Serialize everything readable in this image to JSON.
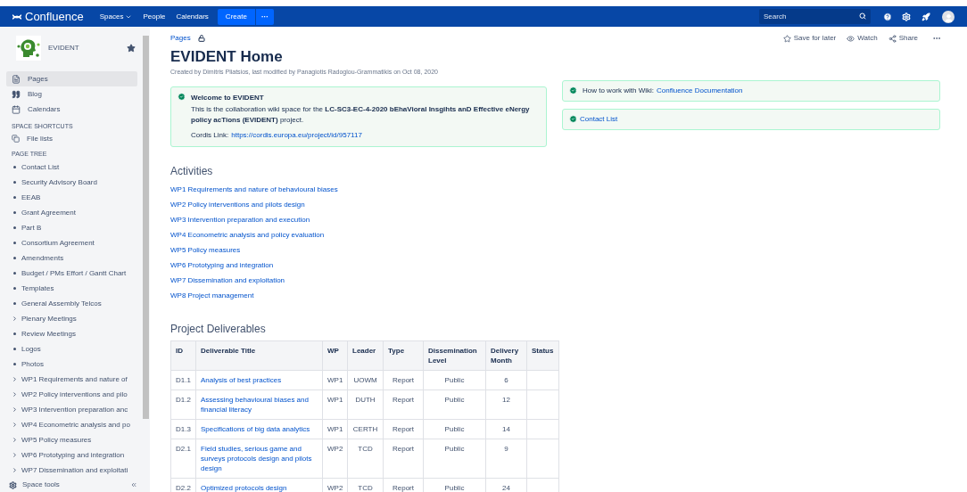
{
  "header": {
    "logo": "Confluence",
    "nav": [
      {
        "label": "Spaces",
        "dropdown": true
      },
      {
        "label": "People",
        "dropdown": false
      },
      {
        "label": "Calendars",
        "dropdown": false
      }
    ],
    "create": "Create",
    "more": "···",
    "search": {
      "placeholder": "Search"
    }
  },
  "sidebar": {
    "space_name": "EVIDENT",
    "nav": [
      {
        "label": "Pages",
        "selected": true
      },
      {
        "label": "Blog",
        "selected": false
      },
      {
        "label": "Calendars",
        "selected": false
      }
    ],
    "shortcuts_heading": "SPACE SHORTCUTS",
    "shortcuts": [
      "File lists"
    ],
    "tree_heading": "PAGE TREE",
    "tree": [
      {
        "label": "Contact List",
        "kind": "leaf"
      },
      {
        "label": "Security Advisory Board",
        "kind": "leaf"
      },
      {
        "label": "EEAB",
        "kind": "leaf"
      },
      {
        "label": "Grant Agreement",
        "kind": "leaf"
      },
      {
        "label": "Part B",
        "kind": "leaf"
      },
      {
        "label": "Consortium Agreement",
        "kind": "leaf"
      },
      {
        "label": "Amendments",
        "kind": "leaf"
      },
      {
        "label": "Budget / PMs Effort / Gantt Chart",
        "kind": "leaf"
      },
      {
        "label": "Templates",
        "kind": "leaf"
      },
      {
        "label": "General Assembly Telcos",
        "kind": "leaf"
      },
      {
        "label": "Plenary Meetings",
        "kind": "folder"
      },
      {
        "label": "Review Meetings",
        "kind": "leaf"
      },
      {
        "label": "Logos",
        "kind": "leaf"
      },
      {
        "label": "Photos",
        "kind": "leaf"
      },
      {
        "label": "WP1 Requirements and nature of",
        "kind": "folder"
      },
      {
        "label": "WP2 Policy interventions and pilo",
        "kind": "folder"
      },
      {
        "label": "WP3 Intervention preparation anc",
        "kind": "folder"
      },
      {
        "label": "WP4 Econometric analysis and po",
        "kind": "folder"
      },
      {
        "label": "WP5 Policy measures",
        "kind": "folder"
      },
      {
        "label": "WP6 Prototyping and integration",
        "kind": "folder"
      },
      {
        "label": "WP7 Dissemination and exploitati",
        "kind": "folder"
      }
    ],
    "footer": "Space tools"
  },
  "page": {
    "breadcrumb": "Pages",
    "actions": [
      "Save for later",
      "Watch",
      "Share"
    ],
    "title": "EVIDENT Home",
    "byline": "Created by Dimitris Pliatsios, last modified by Panagiotis Radoglou-Grammatikis on Oct 08, 2020",
    "welcome": {
      "title": "Welcome to EVIDENT",
      "text": "This is the collaboration wiki space for the **LC-SC3-EC-4-2020 bEhaVioral Insgihts anD Effective eNergy policy acTions (EVIDENT)** project.",
      "cordis_label": "Cordis Link:",
      "cordis_link": "https://cordis.europa.eu/project/id/957117"
    },
    "side_panels": [
      {
        "prefix": "How to work with Wiki:",
        "link": "Confluence Documentation"
      },
      {
        "link": "Contact List"
      }
    ],
    "activities_heading": "Activities",
    "activities": [
      "WP1 Requirements and nature of behavioural biases",
      "WP2 Policy interventions and pilots design",
      "WP3 Intervention preparation and execution",
      "WP4 Econometric analysis and policy evaluation",
      "WP5 Policy measures",
      "WP6 Prototyping and integration",
      "WP7 Dissemination and exploitation",
      "WP8 Project management"
    ],
    "deliverables_heading": "Project Deliverables",
    "table": {
      "columns": [
        "ID",
        "Deliverable Title",
        "WP",
        "Leader",
        "Type",
        "Dissemination Level",
        "Delivery Month",
        "Status"
      ],
      "rows": [
        [
          "D1.1",
          "Analysis of best practices",
          "WP1",
          "UOWM",
          "Report",
          "Public",
          "6",
          ""
        ],
        [
          "D1.2",
          "Assessing behavioural biases and financial literacy",
          "WP1",
          "DUTH",
          "Report",
          "Public",
          "12",
          ""
        ],
        [
          "D1.3",
          "Specifications of big data analytics",
          "WP1",
          "CERTH",
          "Report",
          "Public",
          "14",
          ""
        ],
        [
          "D2.1",
          "Field studies, serious game and surveys protocols design and pilots design",
          "WP2",
          "TCD",
          "Report",
          "Public",
          "9",
          ""
        ],
        [
          "D2.2",
          "Optimized protocols design",
          "WP2",
          "TCD",
          "Report",
          "Public",
          "24",
          ""
        ]
      ]
    }
  }
}
